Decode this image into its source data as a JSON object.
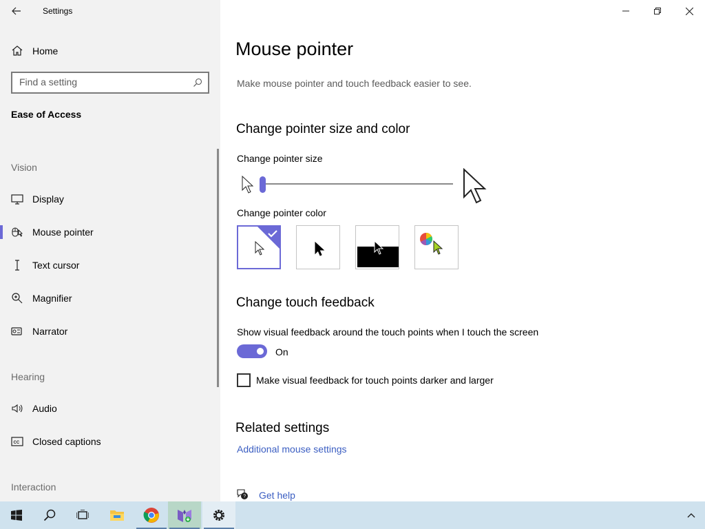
{
  "window": {
    "title": "Settings"
  },
  "sidebar": {
    "home_label": "Home",
    "search_placeholder": "Find a setting",
    "section_title": "Ease of Access",
    "groups": {
      "vision": "Vision",
      "hearing": "Hearing",
      "interaction": "Interaction"
    },
    "items": [
      {
        "label": "Display",
        "icon": "display-icon"
      },
      {
        "label": "Mouse pointer",
        "icon": "mouse-pointer-icon",
        "active": true
      },
      {
        "label": "Text cursor",
        "icon": "text-cursor-icon"
      },
      {
        "label": "Magnifier",
        "icon": "magnifier-icon"
      },
      {
        "label": "Narrator",
        "icon": "narrator-icon"
      },
      {
        "label": "Audio",
        "icon": "audio-icon"
      },
      {
        "label": "Closed captions",
        "icon": "closed-captions-icon"
      }
    ]
  },
  "main": {
    "title": "Mouse pointer",
    "description": "Make mouse pointer and touch feedback easier to see.",
    "pointer_section": {
      "heading": "Change pointer size and color",
      "size_label": "Change pointer size",
      "size_value": 1,
      "color_label": "Change pointer color",
      "color_options": [
        "white",
        "black",
        "inverted",
        "custom"
      ],
      "selected_color": "white"
    },
    "touch_section": {
      "heading": "Change touch feedback",
      "toggle_label": "Show visual feedback around the touch points when I touch the screen",
      "toggle_state": "On",
      "checkbox_label": "Make visual feedback for touch points darker and larger",
      "checkbox_checked": false
    },
    "related": {
      "heading": "Related settings",
      "link": "Additional mouse settings"
    },
    "help_link": "Get help"
  },
  "colors": {
    "accent": "#6b69d6",
    "sidebar_bg": "#f2f2f2",
    "link": "#3b5ec2",
    "taskbar_bg": "#cfe2ee"
  },
  "taskbar": {
    "items": [
      "start-icon",
      "search-icon",
      "task-view-icon",
      "file-explorer-icon",
      "chrome-icon",
      "app-icon",
      "settings-icon"
    ],
    "tray": "chevron-up-icon"
  }
}
